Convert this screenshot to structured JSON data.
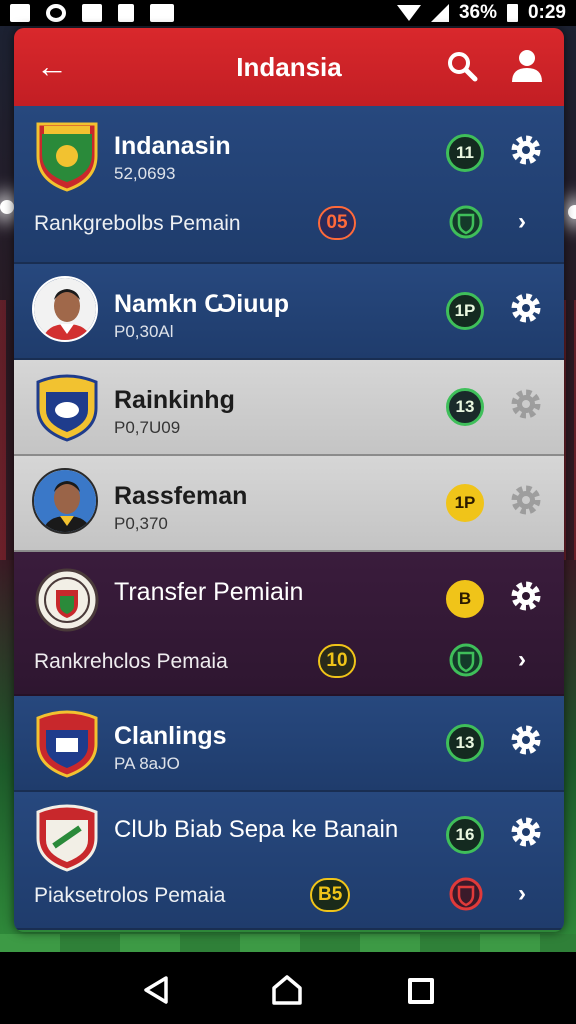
{
  "status_bar": {
    "battery_percent": "36%",
    "time": "0:29",
    "icons": [
      "photo-icon",
      "circle-app-icon",
      "mail-icon",
      "document-icon",
      "image-icon",
      "wifi-icon",
      "signal-icon",
      "battery-icon"
    ]
  },
  "app_bar": {
    "title": "Indansia",
    "icons": [
      "back-arrow-icon",
      "search-icon",
      "user-icon"
    ],
    "color": "#d9282c"
  },
  "cards": [
    {
      "name": "Indanasin",
      "sub": "52,0693",
      "badge": "11",
      "row2": {
        "label": "Rankgrebolbs Pemain",
        "points": "05"
      }
    },
    {
      "name": "Namkn Ѡiuup",
      "sub": "P0,30Al",
      "badge": "1P"
    },
    {
      "name": "Rainkinhg",
      "sub": "P0,7U09",
      "badge": "13"
    },
    {
      "name": "Rassfeman",
      "sub": "P0,370",
      "badge": "1P"
    },
    {
      "name": "Transfer Pemiain",
      "sub": "",
      "badge": "B",
      "row2": {
        "label": "Rankrehclos Pemaia",
        "points": "10"
      }
    },
    {
      "name": "Clanlings",
      "sub": "PA 8aJO",
      "badge": "13"
    },
    {
      "name": "ClUb  Biab Sepa ke Banain",
      "sub": "",
      "badge": "16",
      "row2": {
        "label": "Piaksetrolos Pemaia",
        "points": "B5"
      }
    }
  ],
  "nav_bar": {
    "icons": [
      "nav-back-icon",
      "nav-home-icon",
      "nav-recent-icon"
    ]
  }
}
